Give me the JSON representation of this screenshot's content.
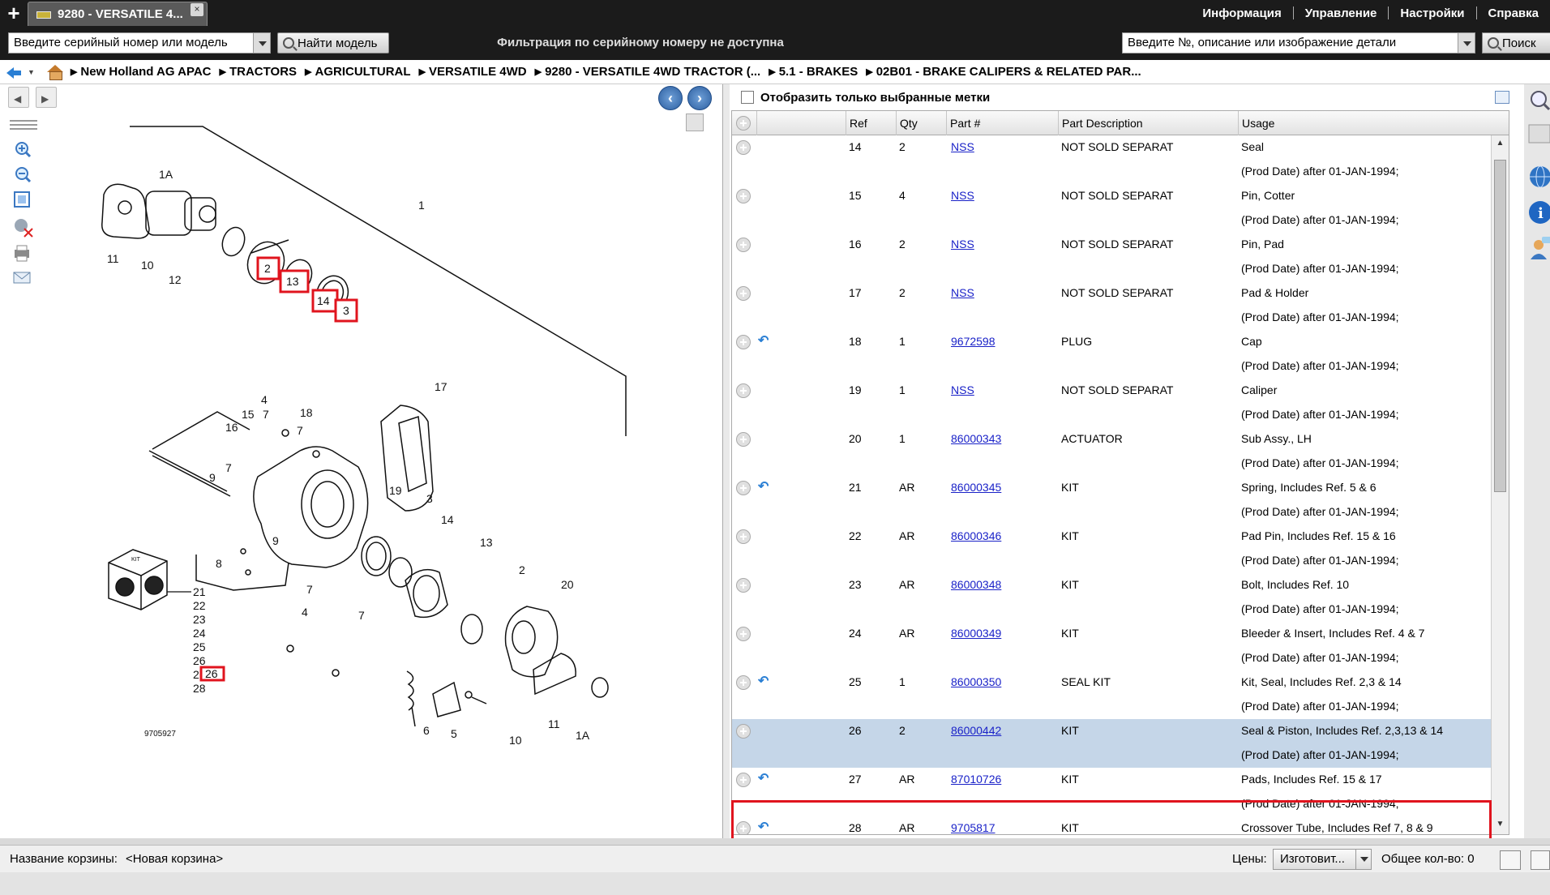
{
  "tab": {
    "title": "9280 - VERSATILE 4...",
    "close": "×"
  },
  "top_menu": [
    "Информация",
    "Управление",
    "Настройки",
    "Справка"
  ],
  "search": {
    "serial_placeholder": "Введите серийный номер или модель",
    "find_model_label": "Найти модель",
    "filter_message": "Фильтрация по серийному номеру не доступна",
    "part_placeholder": "Введите №, описание или изображение детали",
    "search_label": "Поиск"
  },
  "breadcrumb": [
    "New Holland AG APAC",
    "TRACTORS",
    "AGRICULTURAL",
    "VERSATILE 4WD",
    "9280 - VERSATILE 4WD TRACTOR (...",
    "5.1 - BRAKES",
    "02B01 - BRAKE CALIPERS & RELATED PAR..."
  ],
  "filter_checkbox_label": "Отобразить только выбранные метки",
  "grid": {
    "columns": [
      "Ref",
      "Qty",
      "Part #",
      "Part Description",
      "Usage"
    ],
    "rows": [
      {
        "ref": "14",
        "qty": "2",
        "part": "NSS",
        "desc": "NOT SOLD SEPARAT",
        "usage": "Seal",
        "note": "(Prod Date) after 01-JAN-1994;",
        "swap": false,
        "selected": false
      },
      {
        "ref": "15",
        "qty": "4",
        "part": "NSS",
        "desc": "NOT SOLD SEPARAT",
        "usage": "Pin, Cotter",
        "note": "(Prod Date) after 01-JAN-1994;",
        "swap": false,
        "selected": false
      },
      {
        "ref": "16",
        "qty": "2",
        "part": "NSS",
        "desc": "NOT SOLD SEPARAT",
        "usage": "Pin, Pad",
        "note": "(Prod Date) after 01-JAN-1994;",
        "swap": false,
        "selected": false
      },
      {
        "ref": "17",
        "qty": "2",
        "part": "NSS",
        "desc": "NOT SOLD SEPARAT",
        "usage": "Pad & Holder",
        "note": "(Prod Date) after 01-JAN-1994;",
        "swap": false,
        "selected": false
      },
      {
        "ref": "18",
        "qty": "1",
        "part": "9672598",
        "desc": "PLUG",
        "usage": "Cap",
        "note": "(Prod Date) after 01-JAN-1994;",
        "swap": true,
        "selected": false
      },
      {
        "ref": "19",
        "qty": "1",
        "part": "NSS",
        "desc": "NOT SOLD SEPARAT",
        "usage": "Caliper",
        "note": "(Prod Date) after 01-JAN-1994;",
        "swap": false,
        "selected": false
      },
      {
        "ref": "20",
        "qty": "1",
        "part": "86000343",
        "desc": "ACTUATOR",
        "usage": "Sub Assy., LH",
        "note": "(Prod Date) after 01-JAN-1994;",
        "swap": false,
        "selected": false
      },
      {
        "ref": "21",
        "qty": "AR",
        "part": "86000345",
        "desc": "KIT",
        "usage": "Spring, Includes Ref. 5 & 6",
        "note": "(Prod Date) after 01-JAN-1994;",
        "swap": true,
        "selected": false
      },
      {
        "ref": "22",
        "qty": "AR",
        "part": "86000346",
        "desc": "KIT",
        "usage": "Pad Pin, Includes Ref. 15 & 16",
        "note": "(Prod Date) after 01-JAN-1994;",
        "swap": false,
        "selected": false
      },
      {
        "ref": "23",
        "qty": "AR",
        "part": "86000348",
        "desc": "KIT",
        "usage": "Bolt, Includes Ref. 10",
        "note": "(Prod Date) after 01-JAN-1994;",
        "swap": false,
        "selected": false
      },
      {
        "ref": "24",
        "qty": "AR",
        "part": "86000349",
        "desc": "KIT",
        "usage": "Bleeder & Insert, Includes Ref. 4 & 7",
        "note": "(Prod Date) after 01-JAN-1994;",
        "swap": false,
        "selected": false
      },
      {
        "ref": "25",
        "qty": "1",
        "part": "86000350",
        "desc": "SEAL KIT",
        "usage": "Kit, Seal, Includes Ref. 2,3 & 14",
        "note": "(Prod Date) after 01-JAN-1994;",
        "swap": true,
        "selected": false
      },
      {
        "ref": "26",
        "qty": "2",
        "part": "86000442",
        "desc": "KIT",
        "usage": "Seal & Piston, Includes Ref. 2,3,13 & 14",
        "note": "(Prod Date) after 01-JAN-1994;",
        "swap": false,
        "selected": true
      },
      {
        "ref": "27",
        "qty": "AR",
        "part": "87010726",
        "desc": "KIT",
        "usage": "Pads, Includes Ref. 15 & 17",
        "note": "(Prod Date) after 01-JAN-1994;",
        "swap": true,
        "selected": false
      },
      {
        "ref": "28",
        "qty": "AR",
        "part": "9705817",
        "desc": "KIT",
        "usage": "Crossover Tube, Includes Ref 7, 8 & 9",
        "note": "",
        "swap": true,
        "selected": false
      }
    ]
  },
  "diagram": {
    "drawing_number": "9705927",
    "kit_label": "KIT",
    "kit_refs": [
      "21",
      "22",
      "23",
      "24",
      "25",
      "26",
      "27",
      "28"
    ],
    "highlighted_refs": [
      "2",
      "13",
      "14",
      "3",
      "26"
    ],
    "callouts": [
      "1A",
      "11",
      "10",
      "12",
      "1",
      "17",
      "4",
      "15",
      "7",
      "18",
      "16",
      "7",
      "9",
      "7",
      "19",
      "3",
      "14",
      "13",
      "8",
      "9",
      "7",
      "4",
      "7",
      "2",
      "20",
      "6",
      "5",
      "10",
      "11",
      "1A"
    ]
  },
  "status": {
    "basket_label": "Название корзины:",
    "basket_value": "<Новая корзина>",
    "prices_label": "Цены:",
    "prices_value": "Изготовит...",
    "total_qty": "Общее кол-во: 0"
  },
  "colors": {
    "highlight_red": "#e0141e",
    "selected_row": "#c5d6e8",
    "link": "#1a22c8",
    "topbar": "#1b1b1b"
  }
}
